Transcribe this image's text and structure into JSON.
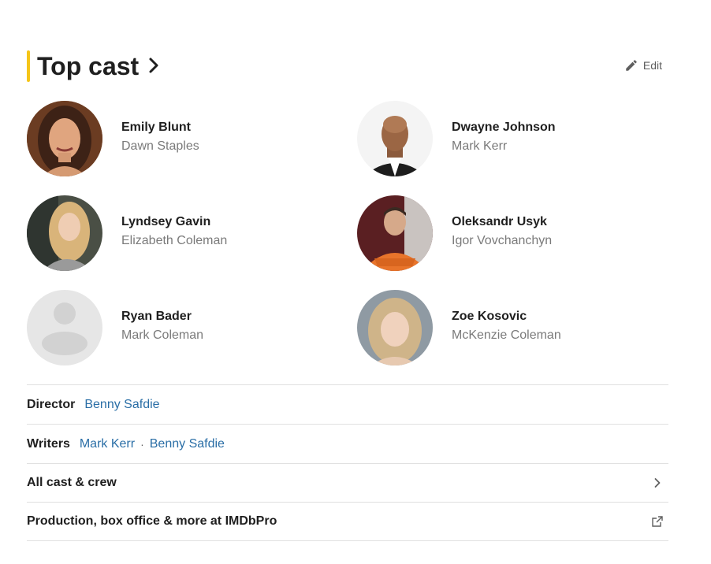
{
  "section": {
    "title": "Top cast",
    "edit_label": "Edit"
  },
  "cast": [
    {
      "actor": "Emily Blunt",
      "role": "Dawn Staples"
    },
    {
      "actor": "Dwayne Johnson",
      "role": "Mark Kerr"
    },
    {
      "actor": "Lyndsey Gavin",
      "role": "Elizabeth Coleman"
    },
    {
      "actor": "Oleksandr Usyk",
      "role": "Igor Vovchanchyn"
    },
    {
      "actor": "Ryan Bader",
      "role": "Mark Coleman"
    },
    {
      "actor": "Zoe Kosovic",
      "role": "McKenzie Coleman"
    }
  ],
  "director": {
    "label": "Director",
    "names": [
      "Benny Safdie"
    ]
  },
  "writers": {
    "label": "Writers",
    "names": [
      "Mark Kerr",
      "Benny Safdie"
    ],
    "separator": "·"
  },
  "all_cast": {
    "label": "All cast & crew"
  },
  "imdbpro": {
    "label": "Production, box office & more at IMDbPro"
  },
  "colors": {
    "accent": "#f5c518",
    "link": "#2a6ea6",
    "muted": "#7a7a7a"
  },
  "icons": {
    "title_chevron": "chevron-right-icon",
    "edit": "pencil-icon",
    "all_cast": "chevron-right-icon",
    "imdbpro": "external-link-icon"
  }
}
